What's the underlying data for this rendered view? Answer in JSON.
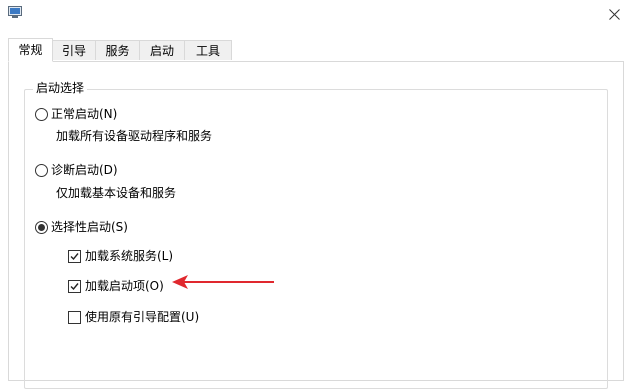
{
  "window": {
    "close_icon": "close-icon",
    "app_icon": "system-config-icon"
  },
  "tabs": [
    {
      "label": "常规",
      "active": true
    },
    {
      "label": "引导",
      "active": false
    },
    {
      "label": "服务",
      "active": false
    },
    {
      "label": "启动",
      "active": false
    },
    {
      "label": "工具",
      "active": false
    }
  ],
  "startup_selection": {
    "group_title": "启动选择",
    "normal": {
      "label": "正常启动(N)",
      "description": "加载所有设备驱动程序和服务",
      "selected": false
    },
    "diagnostic": {
      "label": "诊断启动(D)",
      "description": "仅加载基本设备和服务",
      "selected": false
    },
    "selective": {
      "label": "选择性启动(S)",
      "selected": true
    },
    "options": [
      {
        "label": "加载系统服务(L)",
        "checked": true
      },
      {
        "label": "加载启动项(O)",
        "checked": true
      },
      {
        "label": "使用原有引导配置(U)",
        "checked": false
      }
    ]
  },
  "annotation": {
    "arrow_color": "#e0282e"
  }
}
